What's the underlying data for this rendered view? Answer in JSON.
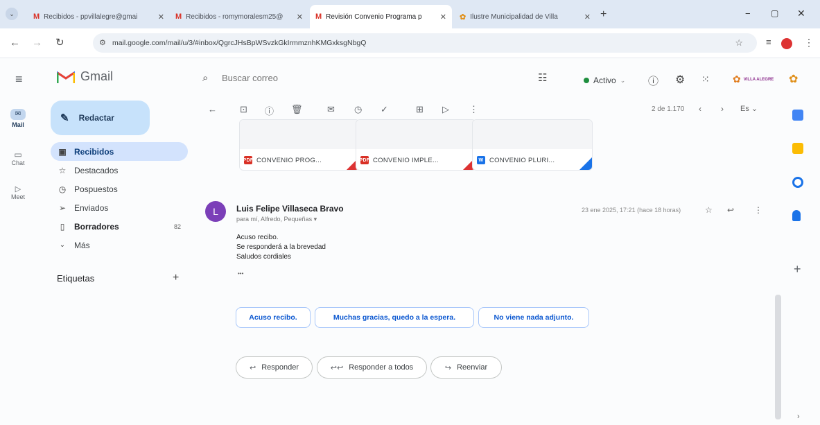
{
  "browser": {
    "tabs": [
      {
        "icon": "M",
        "title": "Recibidos - ppvillalegre@gmai",
        "active": false
      },
      {
        "icon": "M",
        "title": "Recibidos - romymoralesm25@",
        "active": false
      },
      {
        "icon": "M",
        "title": "Revisión Convenio Programa p",
        "active": true
      },
      {
        "icon": "✿",
        "title": "Ilustre Municipalidad de Villa",
        "active": false
      }
    ],
    "new_tab_symbol": "+",
    "url": "mail.google.com/mail/u/3/#inbox/QgrcJHsBpWSvzkGkIrmmznhKMGxksgNbgQ"
  },
  "header": {
    "app_name": "Gmail",
    "search_placeholder": "Buscar correo",
    "status": "Activo",
    "org_logo_text": "VILLA ALEGRE"
  },
  "rail": {
    "mail": "Mail",
    "chat": "Chat",
    "meet": "Meet"
  },
  "sidebar": {
    "compose": "Redactar",
    "items": [
      {
        "label": "Recibidos",
        "icon": "inbox-icon",
        "count": ""
      },
      {
        "label": "Destacados",
        "icon": "star-icon",
        "count": ""
      },
      {
        "label": "Pospuestos",
        "icon": "clock-icon",
        "count": ""
      },
      {
        "label": "Enviados",
        "icon": "send-icon",
        "count": ""
      },
      {
        "label": "Borradores",
        "icon": "draft-icon",
        "count": "82"
      },
      {
        "label": "Más",
        "icon": "chevron-down-icon",
        "count": ""
      }
    ],
    "labels_title": "Etiquetas",
    "labels_add": "+"
  },
  "toolbar": {
    "pager": "2 de 1.170",
    "lang": "Es"
  },
  "attachments": [
    {
      "type": "PDF",
      "name": "CONVENIO PROG...",
      "color": "#d93025"
    },
    {
      "type": "PDF",
      "name": "CONVENIO IMPLE...",
      "color": "#d93025"
    },
    {
      "type": "W",
      "name": "CONVENIO PLURI...",
      "color": "#1a73e8"
    }
  ],
  "message": {
    "avatar": "L",
    "sender": "Luis Felipe Villaseca Bravo",
    "recipients": "para mí, Alfredo, Pequeñas",
    "date": "23 ene 2025, 17:21 (hace 18 horas)",
    "body": [
      "Acuso recibo.",
      "Se responderá a la brevedad",
      "Saludos cordiales"
    ],
    "ellipsis": "•••"
  },
  "smart_replies": [
    "Acuso recibo.",
    "Muchas gracias, quedo a la espera.",
    "No viene nada adjunto."
  ],
  "actions": {
    "reply": "Responder",
    "reply_all": "Responder a todos",
    "forward": "Reenviar"
  },
  "colors": {
    "accent": "#0b57d0",
    "selected_nav": "#d3e3fd",
    "compose_bg": "#c7e2fb",
    "avatar": "#7b3fb8",
    "active_dot": "#1e8e3e"
  }
}
